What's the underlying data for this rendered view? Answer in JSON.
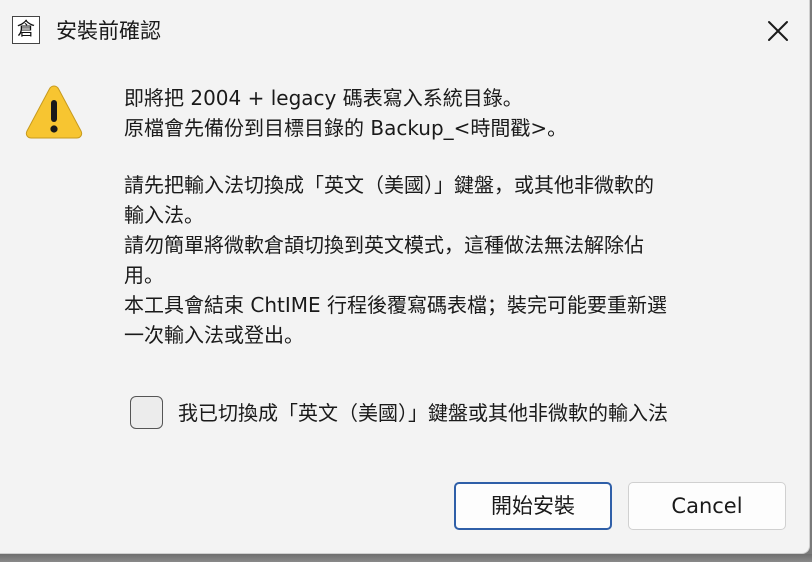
{
  "window": {
    "app_icon_glyph": "倉",
    "title": "安裝前確認"
  },
  "icons": {
    "app": "app-icon",
    "close": "close-icon",
    "warning": "warning-icon",
    "warning_color": "#f7c531"
  },
  "message": {
    "para1": [
      "即將把 2004 + legacy 碼表寫入系統目錄。",
      "原檔會先備份到目標目錄的 Backup_<時間戳>。"
    ],
    "para2": [
      "請先把輸入法切換成「英文（美國）」鍵盤，或其他非微軟的",
      "輸入法。",
      "請勿簡單將微軟倉頡切換到英文模式，這種做法無法解除佔",
      "用。",
      "本工具會結束 ChtIME 行程後覆寫碼表檔；裝完可能要重新選",
      "一次輸入法或登出。"
    ]
  },
  "confirm_checkbox": {
    "label": "我已切換成「英文（美國）」鍵盤或其他非微軟的輸入法",
    "checked": false
  },
  "buttons": {
    "install": "開始安裝",
    "cancel": "Cancel"
  },
  "colors": {
    "dialog_bg": "#f3f3f3",
    "default_button_border": "#2f5fa8"
  }
}
